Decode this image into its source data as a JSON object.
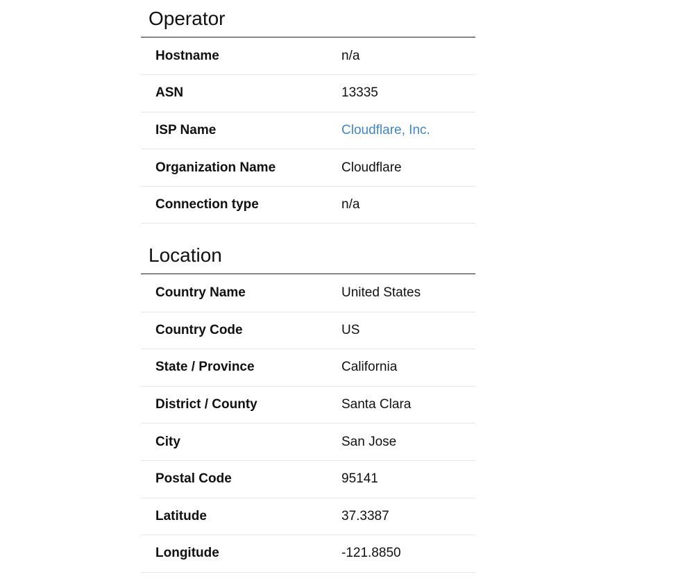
{
  "operator": {
    "title": "Operator",
    "rows": [
      {
        "label": "Hostname",
        "value": "n/a"
      },
      {
        "label": "ASN",
        "value": "13335"
      },
      {
        "label": "ISP Name",
        "value": "Cloudflare, Inc."
      },
      {
        "label": "Organization Name",
        "value": "Cloudflare"
      },
      {
        "label": "Connection type",
        "value": "n/a"
      }
    ]
  },
  "location": {
    "title": "Location",
    "rows": [
      {
        "label": "Country Name",
        "value": "United States"
      },
      {
        "label": "Country Code",
        "value": "US"
      },
      {
        "label": "State / Province",
        "value": "California"
      },
      {
        "label": "District / County",
        "value": "Santa Clara"
      },
      {
        "label": "City",
        "value": "San Jose"
      },
      {
        "label": "Postal Code",
        "value": "95141"
      },
      {
        "label": "Latitude",
        "value": "37.3387"
      },
      {
        "label": "Longitude",
        "value": "-121.8850"
      }
    ]
  },
  "colors": {
    "link": "#3f86d0",
    "text": "#111111",
    "divider": "#e6e6e6"
  }
}
